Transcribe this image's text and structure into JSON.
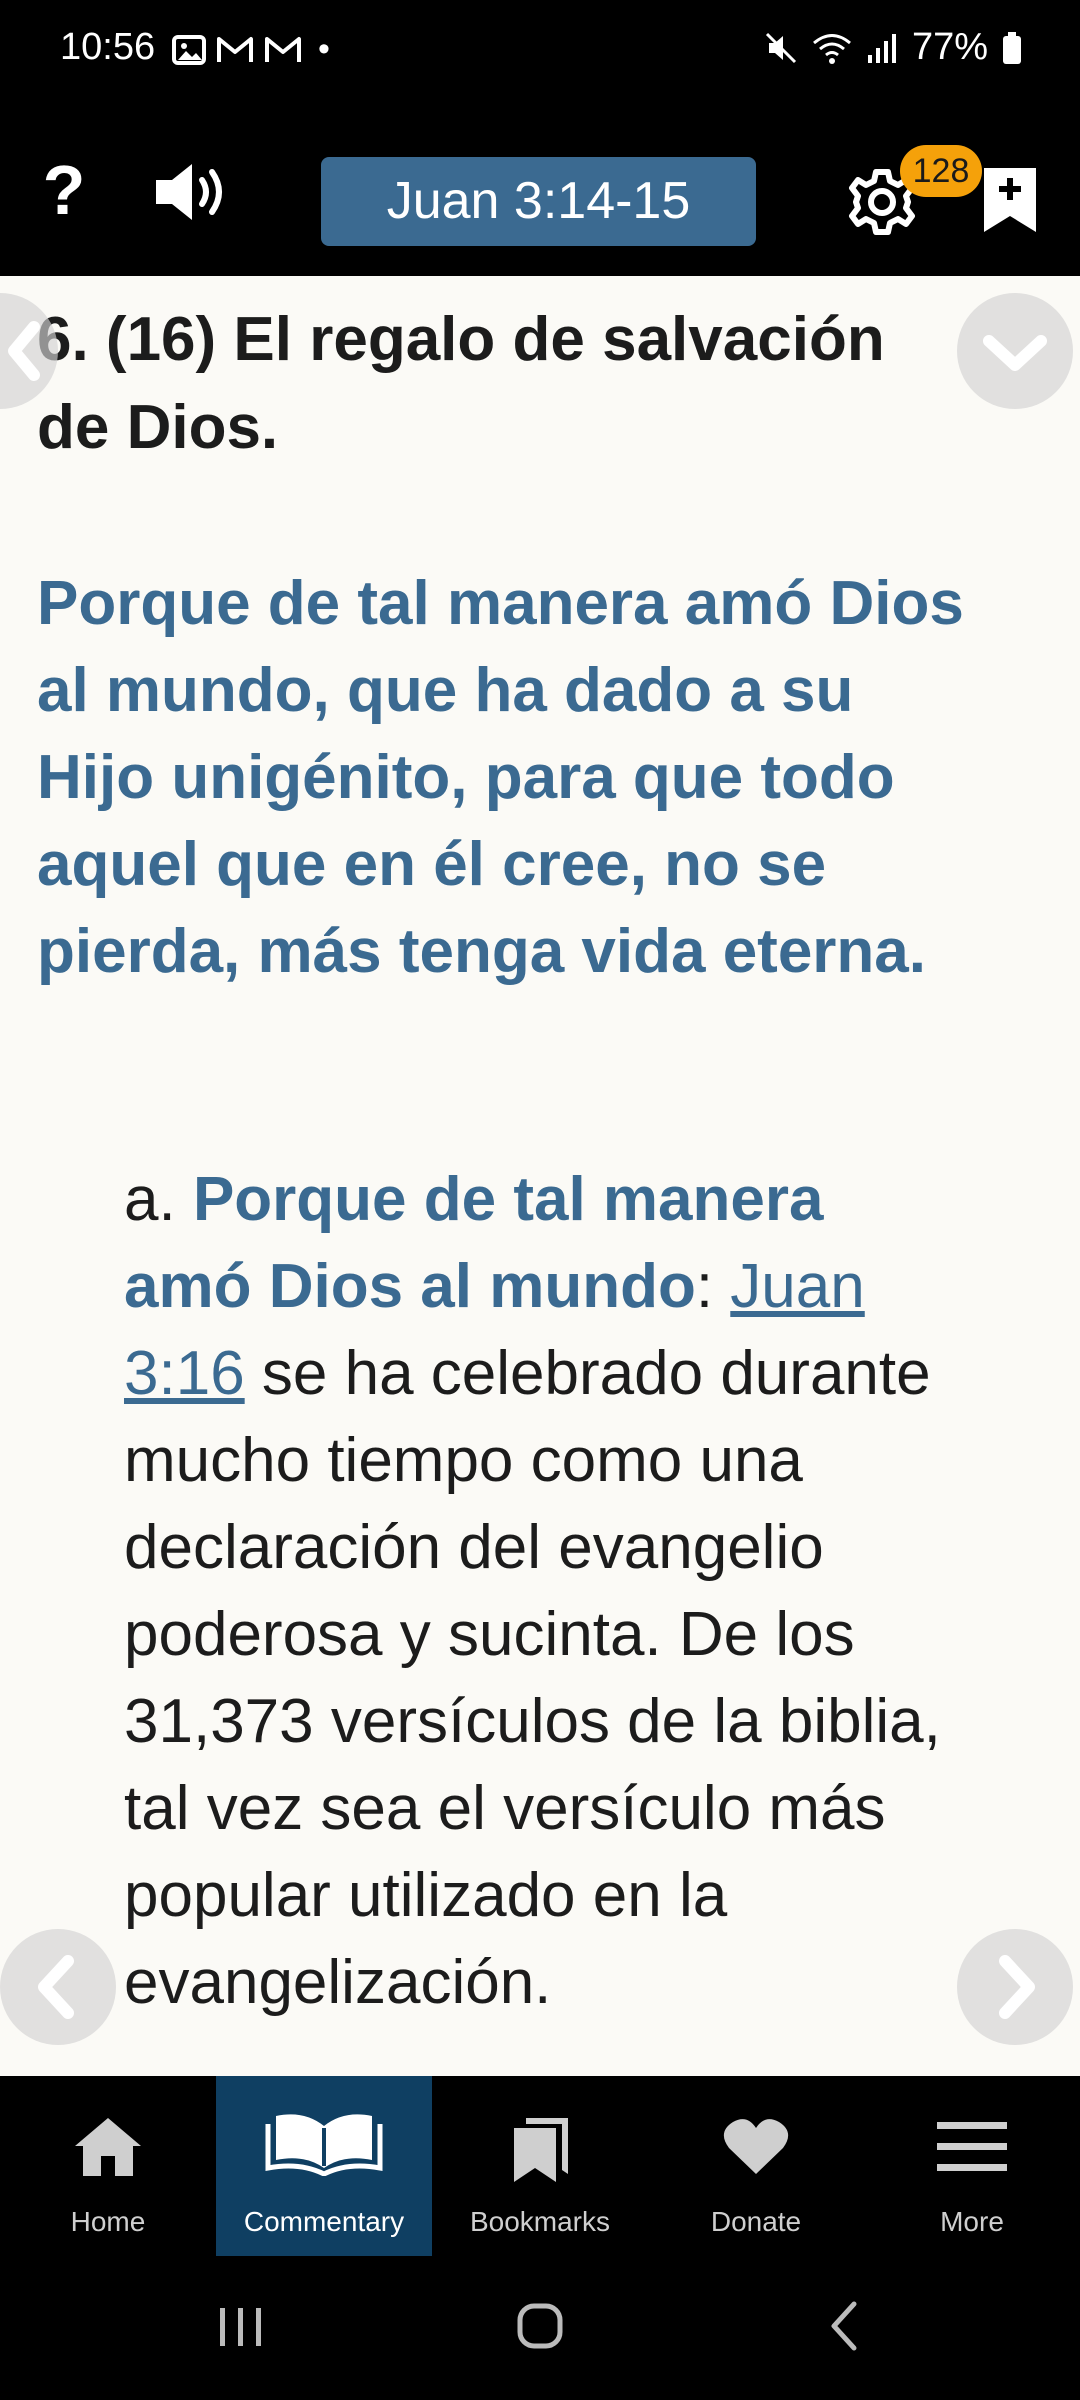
{
  "status_bar": {
    "time": "10:56",
    "dot": "•",
    "battery": "77%",
    "icons": [
      "gallery-icon",
      "gmail-icon",
      "gmail-icon",
      "mute-icon",
      "wifi-icon",
      "signal-icon",
      "battery-icon"
    ]
  },
  "header": {
    "help_label": "?",
    "reference": "Juan 3:14-15",
    "badge_count": "128",
    "icons": [
      "help-icon",
      "speaker-icon",
      "settings-icon",
      "bookmark-add-icon"
    ]
  },
  "content": {
    "heading": "6. (16) El regalo de salvación de Dios.",
    "verse": "Porque de tal manera amó Dios al mundo, que ha dado a su Hijo unigénito, para que todo aquel que en él cree, no se pierda, más tenga vida eterna.",
    "comment": {
      "marker": "a. ",
      "highlight": "Porque de tal manera amó Dios al mundo",
      "colon": ": ",
      "link": "Juan 3:16",
      "text": " se ha celebrado durante mucho tiempo como una declaración del evangelio poderosa y sucinta. De los 31,373 versículos de la biblia, tal vez sea el versículo más popular utilizado en la evangelización."
    }
  },
  "bottom_nav": {
    "items": [
      {
        "label": "Home",
        "icon": "home-icon"
      },
      {
        "label": "Commentary",
        "icon": "open-book-icon",
        "active": true
      },
      {
        "label": "Bookmarks",
        "icon": "bookmarks-icon"
      },
      {
        "label": "Donate",
        "icon": "heart-icon"
      },
      {
        "label": "More",
        "icon": "menu-icon"
      }
    ]
  },
  "colors": {
    "accent": "#3b6a91",
    "badge": "#f5a10a",
    "active_tab": "#0f3f62",
    "page_bg": "#fbfaf6"
  }
}
